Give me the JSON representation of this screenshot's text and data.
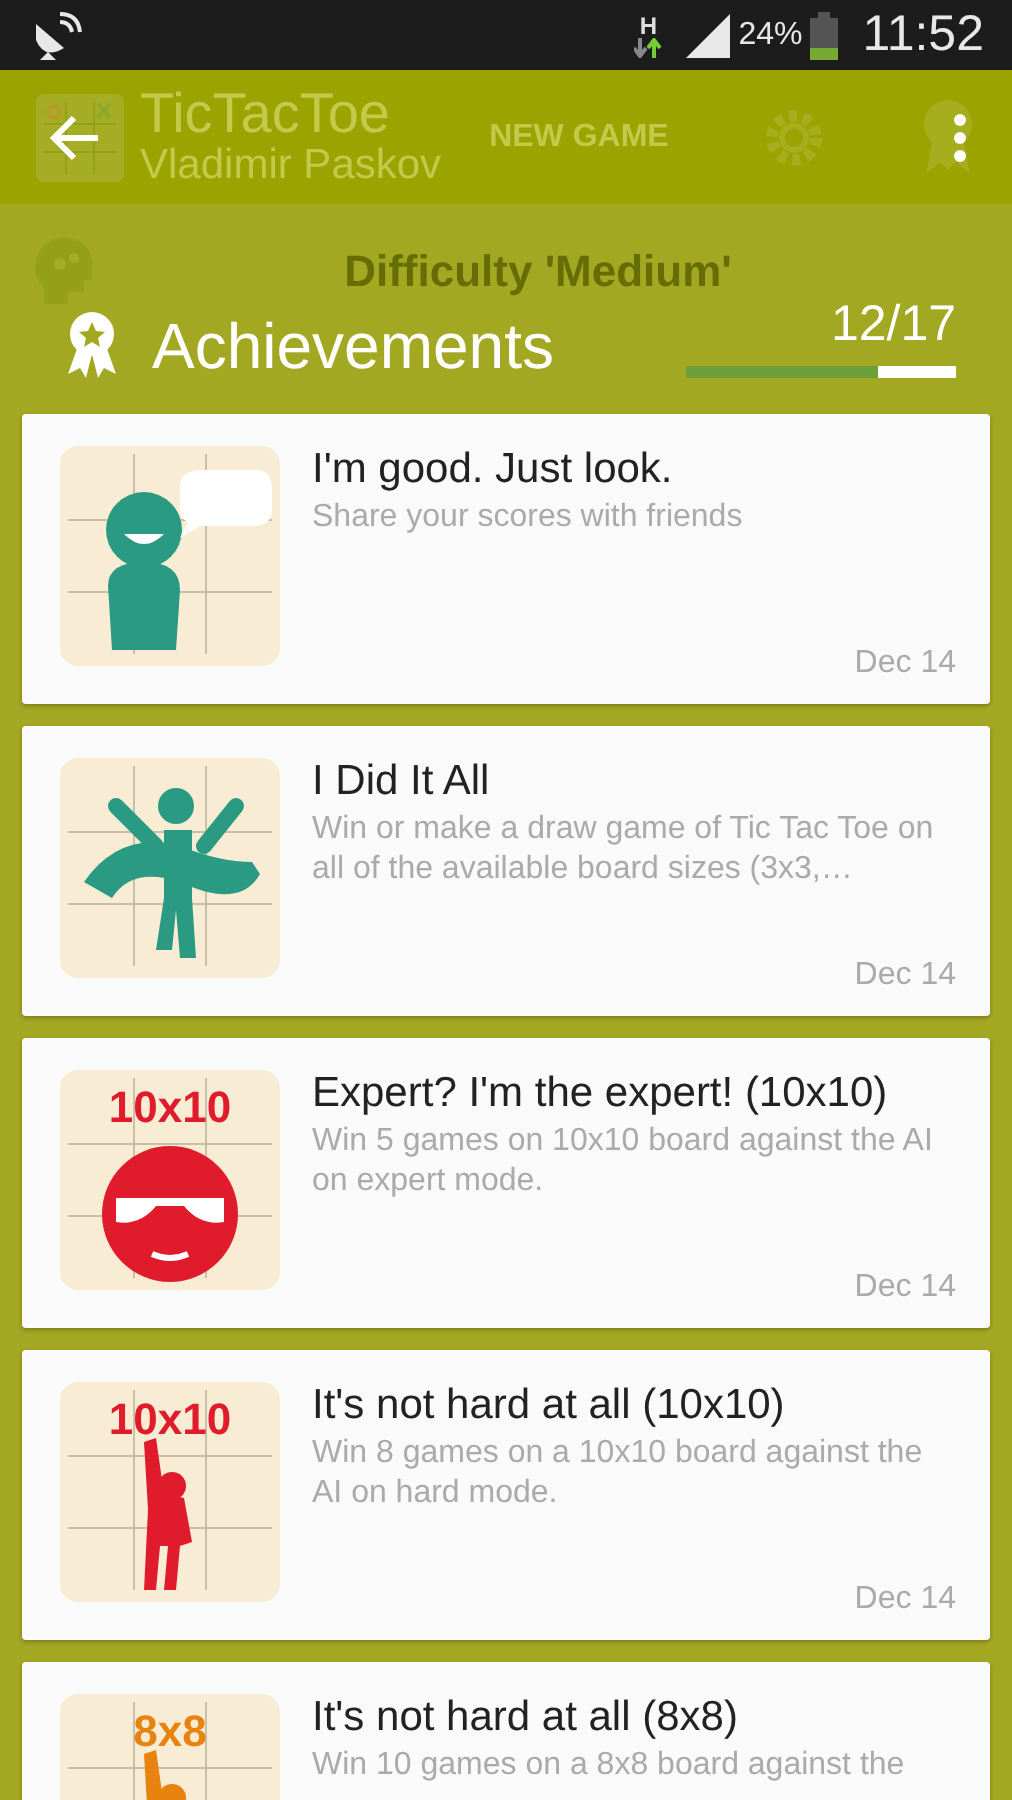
{
  "status_bar": {
    "network_type": "H",
    "battery": "24%",
    "time": "11:52"
  },
  "background": {
    "app_title": "TicTacToe",
    "app_subtitle": "Vladimir Paskov",
    "new_game": "NEW GAME",
    "difficulty": "Difficulty 'Medium'"
  },
  "header": {
    "title": "Achievements",
    "progress": "12/17",
    "level": 0.71
  },
  "achievements": [
    {
      "title": "I'm good. Just look.",
      "description": "Share your scores with friends",
      "date": "Dec 14",
      "kind": "speech",
      "color": "#2b9a82"
    },
    {
      "title": "I Did It All",
      "description": "Win or make a draw game of Tic Tac Toe on all of the available board sizes (3x3,…",
      "date": "Dec 14",
      "kind": "finish",
      "color": "#2b9a82"
    },
    {
      "title": "Expert? I'm the expert! (10x10)",
      "description": "Win 5 games on 10x10 board against the AI on expert mode.",
      "date": "Dec 14",
      "kind": "expert",
      "badge": "10x10",
      "color": "#e01b2c"
    },
    {
      "title": "It's not hard at all (10x10)",
      "description": "Win 8 games on a 10x10 board against the AI on hard mode.",
      "date": "Dec 14",
      "kind": "raise",
      "badge": "10x10",
      "color": "#e01b2c"
    },
    {
      "title": "It's not hard at all (8x8)",
      "description": "Win 10 games on a 8x8 board against the",
      "kind": "raise",
      "badge": "8x8",
      "color": "#e8830f"
    }
  ]
}
